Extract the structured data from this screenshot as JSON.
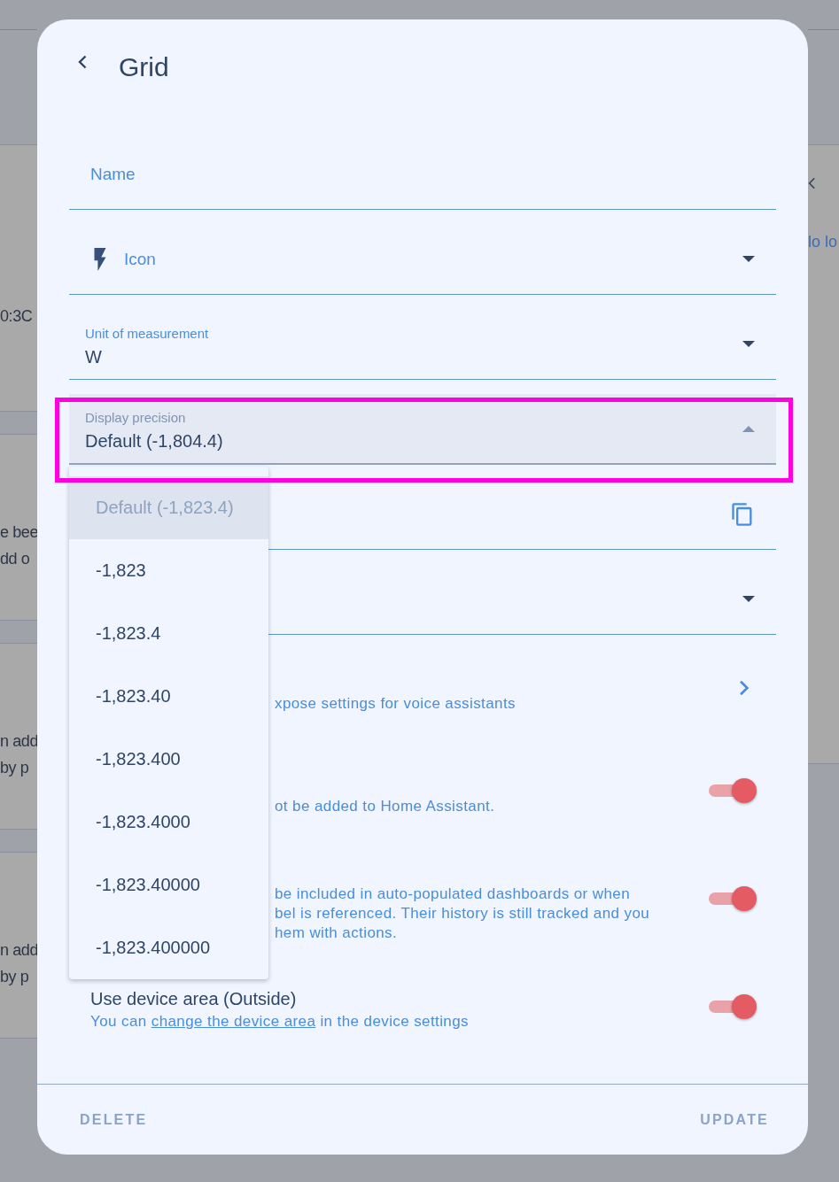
{
  "background": {
    "left_panels": [
      {
        "texts": [
          "0:3C"
        ]
      },
      {
        "texts": [
          "e bee",
          "dd o"
        ]
      },
      {
        "texts": [
          "n add",
          "by p"
        ]
      },
      {
        "texts": [
          "n add",
          "by p"
        ]
      }
    ],
    "right_panel": {
      "texts": [
        "lo lo"
      ]
    }
  },
  "dialog": {
    "title": "Grid",
    "fields": [
      {
        "kind": "text",
        "label": "Name"
      },
      {
        "kind": "icon-select",
        "label": "Icon"
      },
      {
        "kind": "select",
        "label": "Unit of measurement",
        "value": "W",
        "expanded": false
      },
      {
        "kind": "select",
        "label": "Display precision",
        "value": "Default (-1,804.4)",
        "expanded": true,
        "highlighted": true
      },
      {
        "kind": "copy"
      },
      {
        "kind": "select",
        "expanded": false
      }
    ],
    "rows": [
      {
        "kind": "link",
        "lines": [
          "xpose settings for voice assistants"
        ]
      },
      {
        "kind": "toggle",
        "on": true,
        "lines": [
          "ot be added to Home Assistant."
        ]
      },
      {
        "kind": "toggle",
        "on": true,
        "lines": [
          "be included in auto-populated dashboards or when",
          "bel is referenced. Their history is still tracked and you",
          "hem with actions."
        ]
      },
      {
        "kind": "toggle",
        "on": true,
        "title": "Use device area (Outside)",
        "text_before": "You can",
        "link": "change the device area",
        "text_after": "in the device settings"
      }
    ],
    "menu": {
      "options": [
        {
          "label": "Default (-1,823.4)",
          "selected": true
        },
        {
          "label": "-1,823",
          "selected": false
        },
        {
          "label": "-1,823.4",
          "selected": false
        },
        {
          "label": "-1,823.40",
          "selected": false
        },
        {
          "label": "-1,823.400",
          "selected": false
        },
        {
          "label": "-1,823.4000",
          "selected": false
        },
        {
          "label": "-1,823.40000",
          "selected": false
        },
        {
          "label": "-1,823.400000",
          "selected": false
        }
      ]
    },
    "buttons": [
      "DELETE",
      "UPDATE"
    ]
  }
}
